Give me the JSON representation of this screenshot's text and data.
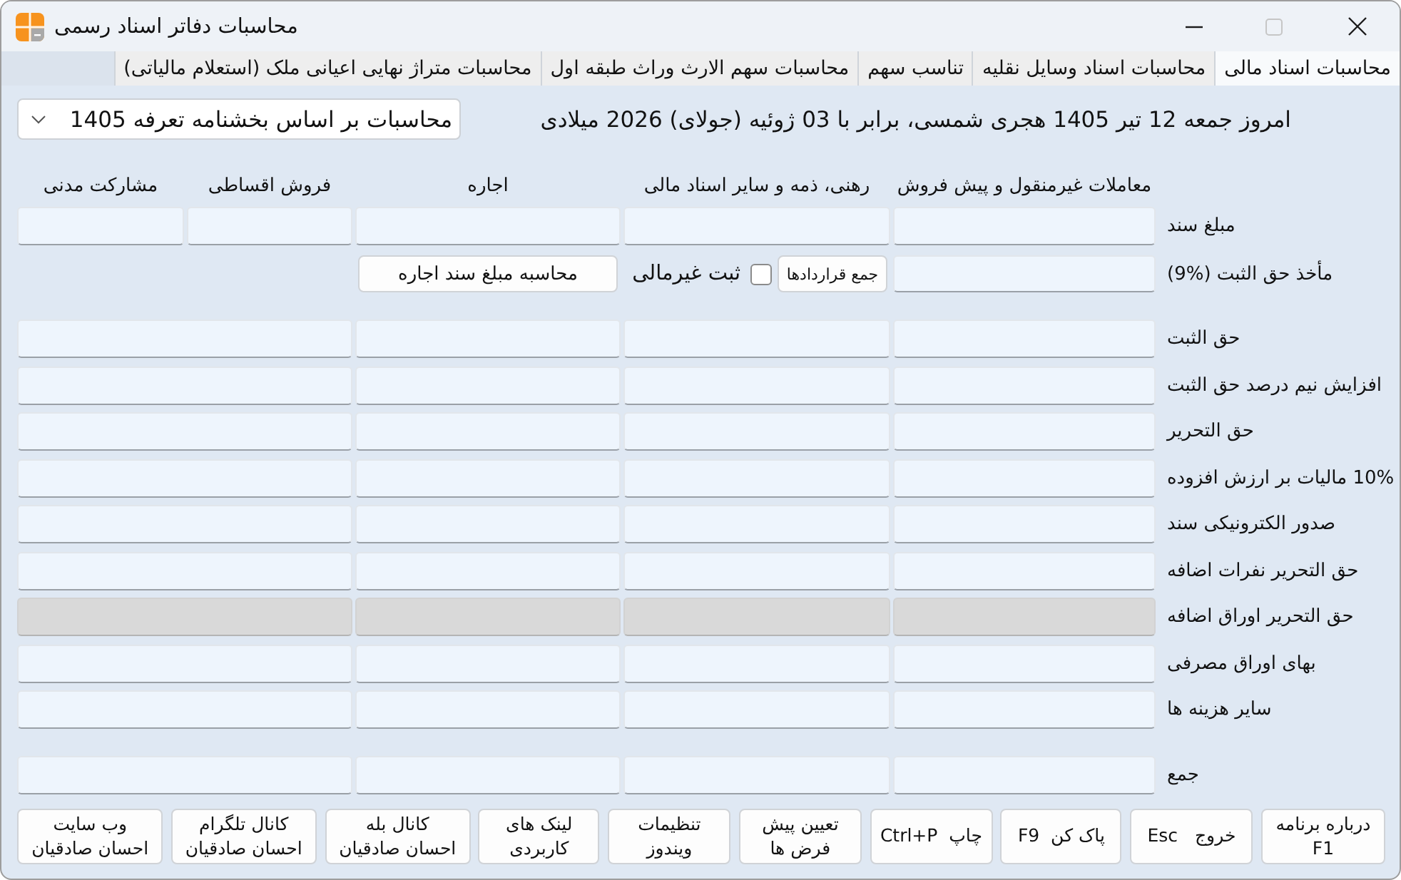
{
  "window": {
    "title": "محاسبات دفاتر اسناد رسمی",
    "controls": [
      {
        "kind": "minimize",
        "disabled": false
      },
      {
        "kind": "maximize",
        "disabled": true
      },
      {
        "kind": "close",
        "disabled": false
      }
    ]
  },
  "tabs": [
    {
      "label": "محاسبات اسناد مالی",
      "selected": true
    },
    {
      "label": "محاسبات اسناد وسایل نقلیه",
      "selected": false
    },
    {
      "label": "تناسب سهم",
      "selected": false
    },
    {
      "label": "محاسبات سهم الارث وراث طبقه اول",
      "selected": false
    },
    {
      "label": "محاسبات متراژ نهایی اعیانی ملک (استعلام مالیاتی)",
      "selected": false
    }
  ],
  "date_text": "امروز جمعه 12 تیر 1405 هجری شمسی، برابر با 03 ژوئیه (جولای) 2026 میلادی",
  "tariff_dropdown": {
    "value": "محاسبات بر اساس بخشنامه تعرفه 1405"
  },
  "columns": [
    "معاملات غیرمنقول و پیش فروش",
    "رهنی، ذمه و سایر اسناد مالی",
    "اجاره",
    "فروش اقساطی",
    "مشارکت مدنی"
  ],
  "amount_row": {
    "label": "مبلغ سند"
  },
  "base_row": {
    "label": "مأخذ حق الثبت (%9)",
    "sum_button": "جمع قراردادها",
    "non_financial": {
      "label": "ثبت غیرمالی",
      "checked": false
    },
    "lease_button": "محاسبه مبلغ سند اجاره"
  },
  "fee_rows": [
    {
      "label": "حق الثبت",
      "disabled": false
    },
    {
      "label": "افزایش نیم درصد حق الثبت",
      "disabled": false
    },
    {
      "label": "حق التحریر",
      "disabled": false
    },
    {
      "label": "10% مالیات بر ارزش افزوده",
      "disabled": false
    },
    {
      "label": "صدور الکترونیکی سند",
      "disabled": false
    },
    {
      "label": "حق التحریر نفرات اضافه",
      "disabled": false
    },
    {
      "label": "حق التحریر اوراق اضافه",
      "disabled": true
    },
    {
      "label": "بهای اوراق مصرفی",
      "disabled": false
    },
    {
      "label": "سایر هزینه ها",
      "disabled": false
    }
  ],
  "total_row": {
    "label": "جمع"
  },
  "buttons": [
    {
      "label": "درباره برنامه\nF1"
    },
    {
      "label": "خروج   Esc"
    },
    {
      "label": "پاک کن  F9"
    },
    {
      "label": "چاپ  Ctrl+P"
    },
    {
      "label": "تعیین پیش\nفرض ها"
    },
    {
      "label": "تنظیمات\nویندوز"
    },
    {
      "label": "لینک های\nکاربردی"
    },
    {
      "label": "کانال بله\nاحسان صادقیان"
    },
    {
      "label": "کانال تلگرام\nاحسان صادقیان"
    },
    {
      "label": "وب سایت\nاحسان صادقیان"
    }
  ]
}
